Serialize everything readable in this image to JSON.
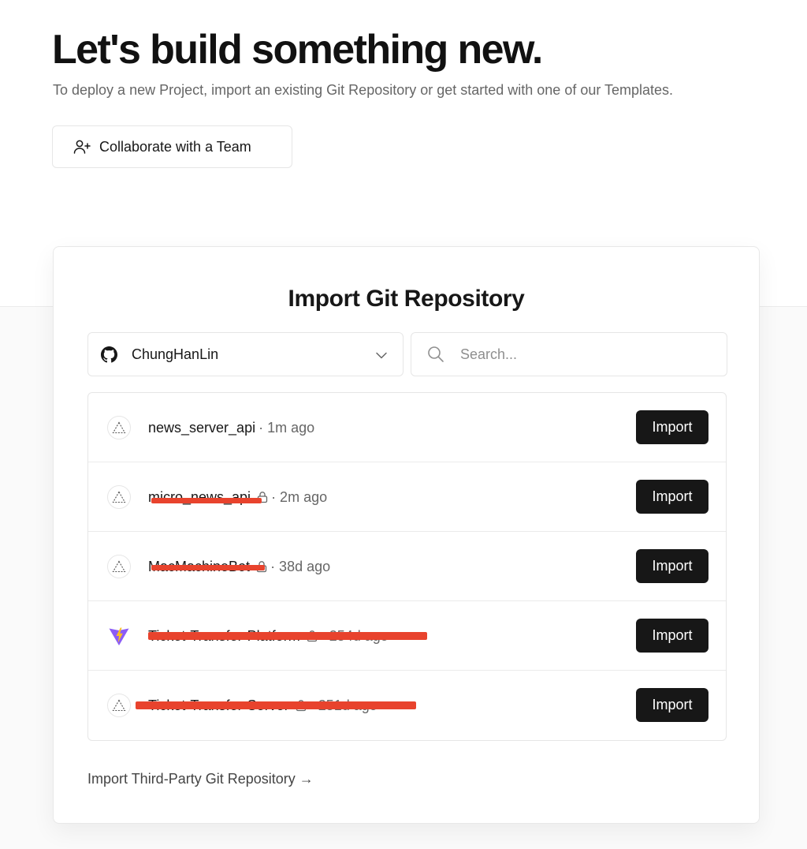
{
  "hero": {
    "title": "Let's build something new.",
    "subtitle": "To deploy a new Project, import an existing Git Repository or get started with one of our Templates.",
    "team_button_label": "Collaborate with a Team",
    "team_button_icon": "user-plus-icon"
  },
  "import_card": {
    "title": "Import Git Repository",
    "account": {
      "name": "ChungHanLin",
      "icon": "github-icon"
    },
    "search": {
      "placeholder": "Search...",
      "value": ""
    },
    "repos": [
      {
        "name": "news_server_api",
        "private": false,
        "meta": "· 1m ago",
        "avatar": "triangle-icon",
        "redacted": false,
        "button": "Import"
      },
      {
        "name": "micro_news_api",
        "private": true,
        "meta": "· 2m ago",
        "avatar": "triangle-icon",
        "redacted": true,
        "button": "Import"
      },
      {
        "name": "MacMachineBot",
        "private": true,
        "meta": "· 38d ago",
        "avatar": "triangle-icon",
        "redacted": true,
        "button": "Import"
      },
      {
        "name": "Ticket-Transfer-Platform",
        "private": true,
        "meta": "· 254d ago",
        "avatar": "vite-icon",
        "redacted": true,
        "button": "Import"
      },
      {
        "name": "Ticket-Transfer-Server",
        "private": true,
        "meta": "· 251d ago",
        "avatar": "triangle-icon",
        "redacted": true,
        "button": "Import"
      }
    ],
    "third_party_link": "Import Third-Party Git Repository →"
  },
  "colors": {
    "primary_button": "#171717",
    "redaction": "#e8432d",
    "border": "#e6e6e6",
    "muted_text": "#666666"
  }
}
